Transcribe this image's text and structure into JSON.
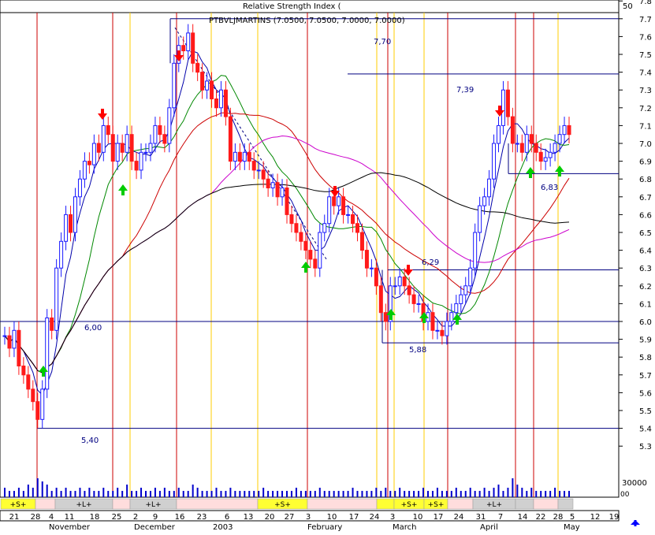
{
  "rsi_panel": {
    "label": "Relative Strength Index (",
    "level": "50"
  },
  "header": {
    "symbol_line": "PTBVLJMARTINS (7.0500, 7.0500, 7.0000, 7.0000)"
  },
  "volume_label": "30000",
  "volume_marker": "00",
  "price_axis": {
    "ticks": [
      "7.8",
      "7.7",
      "7.6",
      "7.5",
      "7.4",
      "7.3",
      "7.2",
      "7.1",
      "7.0",
      "6.9",
      "6.8",
      "6.7",
      "6.6",
      "6.5",
      "6.4",
      "6.3",
      "6.2",
      "6.1",
      "6.0",
      "5.9",
      "5.8",
      "5.7",
      "5.6",
      "5.5",
      "5.4",
      "5.3"
    ]
  },
  "level_labels": [
    "7,70",
    "7,39",
    "6,83",
    "6,29",
    "6,00",
    "5,88",
    "5,40"
  ],
  "date_axis": {
    "days": [
      "21",
      "28",
      "4",
      "11",
      "18",
      "25",
      "2",
      "9",
      "16",
      "23",
      "6",
      "13",
      "20",
      "27",
      "3",
      "10",
      "17",
      "24",
      "3",
      "10",
      "17",
      "24",
      "31",
      "7",
      "14",
      "22",
      "28",
      "5",
      "12",
      "19"
    ],
    "months": [
      "November",
      "December",
      "2003",
      "February",
      "March",
      "April",
      "May"
    ]
  },
  "signal_bar": {
    "segments": [
      "+S+",
      "+L+",
      "+L+",
      "+S+",
      "+S+",
      "+S+",
      "+L+"
    ]
  },
  "colors": {
    "up": "#1a1aff",
    "down": "#ff1a1a",
    "ma_short": "#0000aa",
    "ma_mid": "#008800",
    "ma_long": "#cc0000",
    "ma_200": "#cc00cc",
    "ma_300": "#000000",
    "sell_arrow": "#ff0000",
    "buy_arrow": "#00cc00",
    "signal_yellow": "#ffff33"
  },
  "chart_data": {
    "type": "candlestick",
    "title": "PTBVLJMARTINS (7.0500, 7.0500, 7.0000, 7.0000)",
    "ylim": [
      5.2,
      7.9
    ],
    "series": [
      {
        "name": "price",
        "values": [
          5.92,
          5.85,
          5.95,
          5.75,
          5.7,
          5.62,
          5.55,
          5.45,
          5.62,
          6.02,
          5.95,
          6.3,
          6.45,
          6.6,
          6.5,
          6.7,
          6.8,
          6.9,
          6.88,
          7.0,
          6.95,
          7.1,
          7.05,
          6.9,
          7.0,
          6.95,
          7.05,
          6.9,
          6.85,
          6.95,
          6.95,
          7.0,
          7.1,
          7.05,
          7.0,
          7.2,
          7.45,
          7.55,
          7.52,
          7.62,
          7.45,
          7.4,
          7.3,
          7.35,
          7.25,
          7.2,
          7.3,
          7.15,
          6.9,
          6.95,
          6.9,
          6.95,
          6.9,
          6.85,
          6.85,
          6.8,
          6.75,
          6.78,
          6.7,
          6.75,
          6.6,
          6.55,
          6.5,
          6.45,
          6.4,
          6.35,
          6.3,
          6.5,
          6.55,
          6.7,
          6.65,
          6.7,
          6.6,
          6.6,
          6.55,
          6.5,
          6.4,
          6.3,
          6.3,
          6.2,
          6.05,
          6.0,
          6.2,
          6.2,
          6.25,
          6.2,
          6.15,
          6.1,
          6.1,
          6.0,
          6.05,
          5.95,
          5.95,
          5.92,
          6.0,
          6.05,
          6.1,
          6.15,
          6.2,
          6.3,
          6.5,
          6.65,
          6.7,
          6.8,
          7.0,
          7.1,
          7.3,
          7.15,
          7.0,
          7.0,
          6.95,
          7.05,
          7.0,
          6.95,
          6.9,
          6.92,
          6.95,
          7.0,
          7.05,
          7.1,
          7.05
        ]
      },
      {
        "name": "volume",
        "values": [
          3,
          2,
          2,
          3,
          2,
          4,
          3,
          6,
          5,
          4,
          2,
          3,
          2,
          3,
          2,
          2,
          3,
          2,
          3,
          2,
          2,
          3,
          2,
          2,
          3,
          2,
          4,
          2,
          2,
          3,
          2,
          2,
          3,
          2,
          3,
          2,
          2,
          3,
          2,
          2,
          4,
          3,
          2,
          2,
          2,
          3,
          2,
          2,
          3,
          2,
          2,
          2,
          2,
          2,
          2,
          3,
          2,
          2,
          2,
          2,
          2,
          2,
          3,
          2,
          2,
          2,
          2,
          3,
          2,
          2,
          2,
          2,
          2,
          2,
          3,
          2,
          2,
          2,
          2,
          3,
          2,
          3,
          2,
          2,
          3,
          2,
          2,
          2,
          2,
          3,
          2,
          2,
          3,
          2,
          2,
          2,
          3,
          2,
          2,
          3,
          2,
          2,
          3,
          2,
          3,
          4,
          2,
          3,
          6,
          4,
          3,
          2,
          3,
          2,
          2,
          2,
          2,
          3,
          2,
          2,
          2
        ]
      }
    ],
    "levels": [
      7.7,
      7.39,
      6.83,
      6.29,
      6.0,
      5.88,
      5.4
    ]
  }
}
